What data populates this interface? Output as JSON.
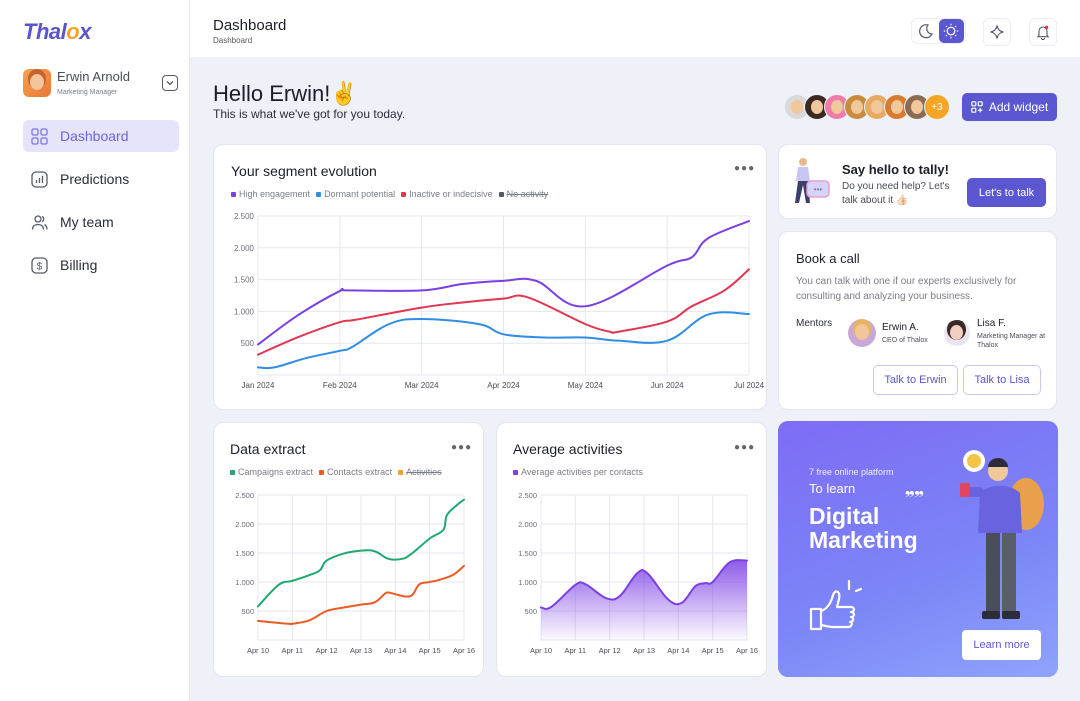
{
  "app": {
    "logo_prefix": "Thal",
    "logo_o": "o",
    "logo_suffix": "x"
  },
  "profile": {
    "name": "Erwin Arnold",
    "role": "Marketing Manager"
  },
  "sidebar": {
    "items": [
      {
        "label": "Dashboard",
        "icon": "grid-icon",
        "active": true
      },
      {
        "label": "Predictions",
        "icon": "chart-icon",
        "active": false
      },
      {
        "label": "My team",
        "icon": "users-icon",
        "active": false
      },
      {
        "label": "Billing",
        "icon": "dollar-icon",
        "active": false
      }
    ]
  },
  "topbar": {
    "title": "Dashboard",
    "breadcrumb": "Dashboard",
    "theme": "light"
  },
  "greeting": {
    "title": "Hello Erwin!✌️",
    "subtitle": "This is what we've got for you today."
  },
  "team": {
    "avatars": [
      "#d9d9d9",
      "#3a2a22",
      "#f07aa8",
      "#c98b3c",
      "#e8a963",
      "#d97b2c",
      "#8b6b52"
    ],
    "more_label": "+3"
  },
  "add_widget_label": "Add widget",
  "colors": {
    "accent": "#5b57d1",
    "purple": "#7b3fe4",
    "blue": "#2f8de4",
    "red": "#e0364f",
    "green": "#1fa971",
    "orange": "#ee5a24",
    "yellow": "#f5a524"
  },
  "segment_card": {
    "title": "Your segment evolution",
    "legend": [
      {
        "label": "High engagement",
        "color": "#7b3fe4",
        "disabled": false
      },
      {
        "label": "Dormant potential",
        "color": "#2f8de4",
        "disabled": false
      },
      {
        "label": "Inactive or indecisive",
        "color": "#e0364f",
        "disabled": false
      },
      {
        "label": "No activity",
        "color": "#555a66",
        "disabled": true
      }
    ]
  },
  "tally": {
    "title": "Say hello to tally!",
    "text": "Do you need help? Let's talk about it 👍🏻",
    "button": "Let's to talk"
  },
  "book_call": {
    "title": "Book a call",
    "text": "You can talk with one if our experts exclusively for consulting and analyzing your business.",
    "mentors_label": "Mentors",
    "mentors": [
      {
        "name": "Erwin A.",
        "role": "CEO of Thalox"
      },
      {
        "name": "Lisa F.",
        "role": "Marketing Manager at Thalox"
      }
    ],
    "buttons": [
      "Talk to Erwin",
      "Talk to Lisa"
    ]
  },
  "data_extract": {
    "title": "Data extract",
    "legend": [
      {
        "label": "Campaigns extract",
        "color": "#1fa971",
        "disabled": false
      },
      {
        "label": "Contacts extract",
        "color": "#ee5a24",
        "disabled": false
      },
      {
        "label": "Activities",
        "color": "#f5a524",
        "disabled": true
      }
    ]
  },
  "avg_activities": {
    "title": "Average activities",
    "legend": [
      {
        "label": "Average activities per contacts",
        "color": "#7b3fe4",
        "disabled": false
      }
    ]
  },
  "promo": {
    "eyebrow": "7 free online platform",
    "lead": "To learn",
    "headline_1": "Digital",
    "headline_2": "Marketing",
    "button": "Learn more"
  },
  "chart_data": [
    {
      "type": "line",
      "title": "Your segment evolution",
      "x": [
        "Jan 2024",
        "Feb 2024",
        "Mar 2024",
        "Apr 2024",
        "May 2024",
        "Jun 2024",
        "Jul 2024"
      ],
      "yticks": [
        500,
        1000,
        1500,
        2000,
        2500
      ],
      "ylim": [
        0,
        2500
      ],
      "grid": true,
      "series": [
        {
          "name": "High engagement",
          "color": "#7b3fe4",
          "points": [
            [
              0,
              480
            ],
            [
              0.5,
              950
            ],
            [
              1,
              1320
            ],
            [
              1.1,
              1330
            ],
            [
              2,
              1330
            ],
            [
              2.5,
              1430
            ],
            [
              3,
              1480
            ],
            [
              3.4,
              1480
            ],
            [
              4,
              1080
            ],
            [
              5,
              1720
            ],
            [
              5.3,
              1850
            ],
            [
              5.5,
              2150
            ],
            [
              6,
              2420
            ]
          ]
        },
        {
          "name": "Dormant potential",
          "color": "#2f8de4",
          "points": [
            [
              0,
              120
            ],
            [
              0.2,
              120
            ],
            [
              0.6,
              270
            ],
            [
              1,
              380
            ],
            [
              1.15,
              440
            ],
            [
              1.6,
              800
            ],
            [
              2,
              880
            ],
            [
              2.7,
              800
            ],
            [
              3,
              640
            ],
            [
              3.5,
              590
            ],
            [
              4,
              590
            ],
            [
              4.4,
              540
            ],
            [
              5,
              540
            ],
            [
              5.5,
              950
            ],
            [
              6,
              960
            ]
          ]
        },
        {
          "name": "Inactive or indecisive",
          "color": "#e0364f",
          "points": [
            [
              0,
              320
            ],
            [
              0.5,
              600
            ],
            [
              1,
              830
            ],
            [
              1.2,
              870
            ],
            [
              2,
              1060
            ],
            [
              2.5,
              1140
            ],
            [
              3,
              1200
            ],
            [
              3.3,
              1220
            ],
            [
              4,
              800
            ],
            [
              4.3,
              680
            ],
            [
              4.4,
              680
            ],
            [
              5,
              840
            ],
            [
              5.3,
              1080
            ],
            [
              5.7,
              1330
            ],
            [
              6,
              1660
            ]
          ]
        },
        {
          "name": "No activity",
          "color": "#555a66",
          "hidden": true,
          "points": []
        }
      ]
    },
    {
      "type": "line",
      "title": "Data extract",
      "x": [
        "Apr 10",
        "Apr 11",
        "Apr 12",
        "Apr 13",
        "Apr 14",
        "Apr 15",
        "Apr 16"
      ],
      "yticks": [
        500,
        1000,
        1500,
        2000,
        2500
      ],
      "ylim": [
        0,
        2500
      ],
      "grid": true,
      "series": [
        {
          "name": "Campaigns extract",
          "color": "#1fa971",
          "points": [
            [
              0,
              580
            ],
            [
              0.6,
              950
            ],
            [
              1,
              1020
            ],
            [
              1.5,
              1120
            ],
            [
              1.8,
              1200
            ],
            [
              2,
              1370
            ],
            [
              2.5,
              1490
            ],
            [
              3,
              1540
            ],
            [
              3.4,
              1530
            ],
            [
              3.8,
              1400
            ],
            [
              4.2,
              1400
            ],
            [
              4.5,
              1500
            ],
            [
              5,
              1750
            ],
            [
              5.4,
              1900
            ],
            [
              5.5,
              2150
            ],
            [
              5.8,
              2330
            ],
            [
              6,
              2420
            ]
          ]
        },
        {
          "name": "Contacts extract",
          "color": "#ee5a24",
          "points": [
            [
              0,
              330
            ],
            [
              0.5,
              300
            ],
            [
              0.9,
              280
            ],
            [
              1,
              280
            ],
            [
              1.5,
              340
            ],
            [
              2,
              500
            ],
            [
              2.5,
              560
            ],
            [
              3,
              610
            ],
            [
              3.4,
              650
            ],
            [
              3.7,
              800
            ],
            [
              3.8,
              820
            ],
            [
              4,
              790
            ],
            [
              4.3,
              750
            ],
            [
              4.5,
              780
            ],
            [
              4.7,
              960
            ],
            [
              5,
              1000
            ],
            [
              5.3,
              1040
            ],
            [
              5.7,
              1130
            ],
            [
              6,
              1280
            ]
          ]
        },
        {
          "name": "Activities",
          "color": "#f5a524",
          "hidden": true,
          "points": []
        }
      ]
    },
    {
      "type": "area",
      "title": "Average activities",
      "x": [
        "Apr 10",
        "Apr 11",
        "Apr 12",
        "Apr 13",
        "Apr 14",
        "Apr 15",
        "Apr 16"
      ],
      "yticks": [
        500,
        1000,
        1500,
        2000,
        2500
      ],
      "ylim": [
        0,
        2500
      ],
      "grid": true,
      "series": [
        {
          "name": "Average activities per contacts",
          "color": "#7b3fe4",
          "points": [
            [
              0,
              560
            ],
            [
              0.3,
              570
            ],
            [
              1,
              950
            ],
            [
              1.3,
              960
            ],
            [
              1.9,
              720
            ],
            [
              2.3,
              760
            ],
            [
              2.8,
              1150
            ],
            [
              3.1,
              1150
            ],
            [
              3.7,
              700
            ],
            [
              4.1,
              640
            ],
            [
              4.5,
              930
            ],
            [
              4.8,
              980
            ],
            [
              5,
              1000
            ],
            [
              5.5,
              1340
            ],
            [
              6,
              1370
            ]
          ]
        }
      ]
    }
  ]
}
